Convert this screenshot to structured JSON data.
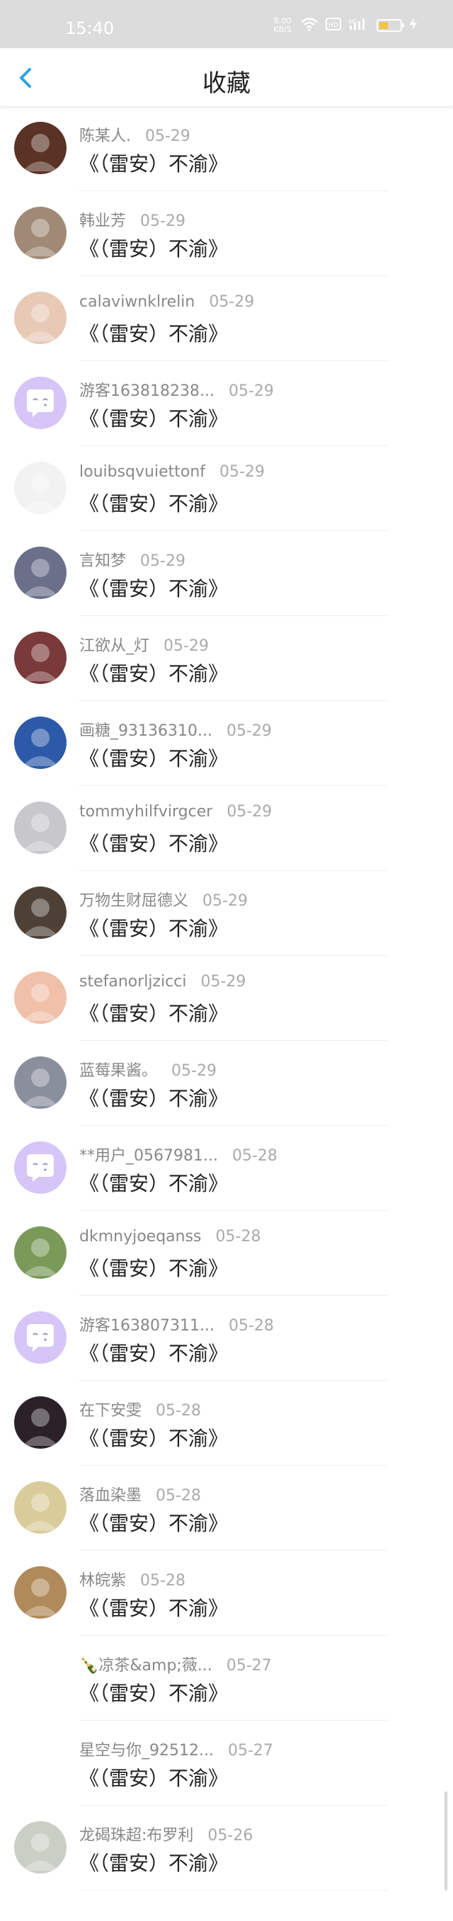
{
  "status": {
    "time": "15:40",
    "speed_value": "8.00",
    "speed_unit": "KB/S",
    "hd_label": "HD",
    "net_label": "4G"
  },
  "header": {
    "title": "收藏"
  },
  "items": [
    {
      "name": "陈某人.",
      "date": "05-29",
      "text": "《（雷安）不渝》",
      "avatar_color": "#5a3326",
      "avatar_icon": "photo-avatar"
    },
    {
      "name": "韩业芳",
      "date": "05-29",
      "text": "《（雷安）不渝》",
      "avatar_color": "#a08a76",
      "avatar_icon": "photo-avatar"
    },
    {
      "name": "calaviwnklrelin",
      "date": "05-29",
      "text": "《（雷安）不渝》",
      "avatar_color": "#e7c9b6",
      "avatar_icon": "photo-avatar"
    },
    {
      "name": "游客163818238...",
      "date": "05-29",
      "text": "《（雷安）不渝》",
      "avatar_color": "#d6c6f7",
      "avatar_icon": "default-chat-avatar"
    },
    {
      "name": "louibsqvuiettonf",
      "date": "05-29",
      "text": "《（雷安）不渝》",
      "avatar_color": "#f2f2f2",
      "avatar_icon": "photo-avatar"
    },
    {
      "name": "言知梦",
      "date": "05-29",
      "text": "《（雷安）不渝》",
      "avatar_color": "#6b6f8a",
      "avatar_icon": "photo-avatar"
    },
    {
      "name": "江欲从_灯",
      "date": "05-29",
      "text": "《（雷安）不渝》",
      "avatar_color": "#7a3a3a",
      "avatar_icon": "photo-avatar"
    },
    {
      "name": "画糖_93136310...",
      "date": "05-29",
      "text": "《（雷安）不渝》",
      "avatar_color": "#2c5aa8",
      "avatar_icon": "photo-avatar"
    },
    {
      "name": "tommyhilfvirgcer",
      "date": "05-29",
      "text": "《（雷安）不渝》",
      "avatar_color": "#c8c8cc",
      "avatar_icon": "photo-avatar"
    },
    {
      "name": "万物生财屈德义",
      "date": "05-29",
      "text": "《（雷安）不渝》",
      "avatar_color": "#4d4036",
      "avatar_icon": "photo-avatar"
    },
    {
      "name": "stefanorljzicci",
      "date": "05-29",
      "text": "《（雷安）不渝》",
      "avatar_color": "#f0c0a8",
      "avatar_icon": "photo-avatar"
    },
    {
      "name": "蓝莓果酱。",
      "date": "05-29",
      "text": "《（雷安）不渝》",
      "avatar_color": "#8a8f9e",
      "avatar_icon": "photo-avatar"
    },
    {
      "name": "**用户_0567981...",
      "date": "05-28",
      "text": "《（雷安）不渝》",
      "avatar_color": "#d6c6f7",
      "avatar_icon": "default-chat-avatar"
    },
    {
      "name": "dkmnyjoeqanss",
      "date": "05-28",
      "text": "《（雷安）不渝》",
      "avatar_color": "#7a9a5a",
      "avatar_icon": "photo-avatar"
    },
    {
      "name": "游客163807311...",
      "date": "05-28",
      "text": "《（雷安）不渝》",
      "avatar_color": "#d6c6f7",
      "avatar_icon": "default-chat-avatar"
    },
    {
      "name": "在下安雯",
      "date": "05-28",
      "text": "《（雷安）不渝》",
      "avatar_color": "#2a2228",
      "avatar_icon": "photo-avatar"
    },
    {
      "name": "落血染墨",
      "date": "05-28",
      "text": "《（雷安）不渝》",
      "avatar_color": "#d9cc9a",
      "avatar_icon": "photo-avatar"
    },
    {
      "name": "林皖紫",
      "date": "05-28",
      "text": "《（雷安）不渝》",
      "avatar_color": "#b08a5a",
      "avatar_icon": "photo-avatar"
    },
    {
      "name": "🍾凉茶&amp;薇...",
      "date": "05-27",
      "text": "《（雷安）不渝》",
      "avatar_color": "#ffffff",
      "avatar_icon": "blank-avatar"
    },
    {
      "name": "星空与你_92512...",
      "date": "05-27",
      "text": "《（雷安）不渝》",
      "avatar_color": "#ffffff",
      "avatar_icon": "blank-avatar"
    },
    {
      "name": "龙碣珠超:布罗利",
      "date": "05-26",
      "text": "《（雷安）不渝》",
      "avatar_color": "#c9cfc4",
      "avatar_icon": "photo-avatar"
    }
  ],
  "colors": {
    "accent": "#2aa4e0",
    "status_bar": "#dcdcdc",
    "default_avatar": "#d6c6f7"
  }
}
